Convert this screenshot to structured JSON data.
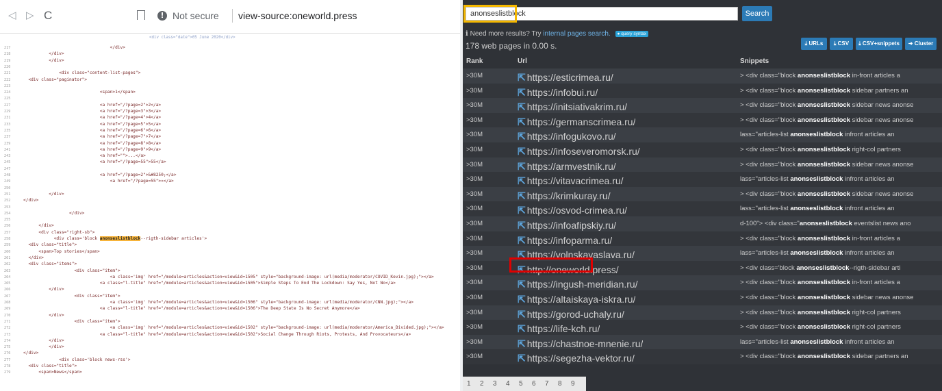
{
  "browser": {
    "nav": {
      "back": "◁",
      "forward": "▷",
      "reload": "C"
    },
    "security_label": "Not secure",
    "url": "view-source:oneworld.press"
  },
  "source": {
    "truncated_top": "<div class=\"date\">05 June 2020</div>",
    "lines": [
      {
        "n": "217",
        "code": "                                  </div>"
      },
      {
        "n": "218",
        "code": "          </div>"
      },
      {
        "n": "219",
        "code": "          </div>"
      },
      {
        "n": "220",
        "code": ""
      },
      {
        "n": "221",
        "code": "              <div class=\"content-list-pages\">"
      },
      {
        "n": "222",
        "code": "  <div class=\"paginator\">"
      },
      {
        "n": "223",
        "code": ""
      },
      {
        "n": "224",
        "code": "                              <span>1</span>"
      },
      {
        "n": "225",
        "code": ""
      },
      {
        "n": "227",
        "code": "                              <a href=\"/?page=2\">2</a>"
      },
      {
        "n": "229",
        "code": "                              <a href=\"/?page=3\">3</a>"
      },
      {
        "n": "231",
        "code": "                              <a href=\"/?page=4\">4</a>"
      },
      {
        "n": "233",
        "code": "                              <a href=\"/?page=5\">5</a>"
      },
      {
        "n": "235",
        "code": "                              <a href=\"/?page=6\">6</a>"
      },
      {
        "n": "237",
        "code": "                              <a href=\"/?page=7\">7</a>"
      },
      {
        "n": "239",
        "code": "                              <a href=\"/?page=8\">8</a>"
      },
      {
        "n": "241",
        "code": "                              <a href=\"/?page=9\">9</a>"
      },
      {
        "n": "243",
        "code": "                              <a href=\"\">...</a>"
      },
      {
        "n": "245",
        "code": "                              <a href=\"/?page=55\">55</a>"
      },
      {
        "n": "247",
        "code": ""
      },
      {
        "n": "248",
        "code": "                              <a href=\"/?page=2\">&#8250;</a>"
      },
      {
        "n": "249",
        "code": "                                  <a href=\"/?page=55\">»</a>"
      },
      {
        "n": "250",
        "code": ""
      },
      {
        "n": "251",
        "code": "          </div>"
      },
      {
        "n": "252",
        "code": "</div>"
      },
      {
        "n": "253",
        "code": ""
      },
      {
        "n": "254",
        "code": "                  </div>"
      },
      {
        "n": "255",
        "code": ""
      },
      {
        "n": "256",
        "code": "      </div>"
      },
      {
        "n": "257",
        "code": "      <div class=\"right-sb\">"
      },
      {
        "n": "258",
        "pre": "            <div class='block ",
        "hl": "anonseslistblock",
        "post": "--rigth-sidebar articles'>"
      },
      {
        "n": "259",
        "code": "  <div class=\"title\">"
      },
      {
        "n": "260",
        "code": "      <span>Top stories</span>"
      },
      {
        "n": "261",
        "code": "  </div>"
      },
      {
        "n": "262",
        "code": "  <div class=\"items\">"
      },
      {
        "n": "263",
        "code": "                    <div class=\"item\">"
      },
      {
        "n": "264",
        "code": "                                  <a class='img' href=\"/module=articles&action=view&id=1505\" style=\"background-image: url(media/moderator/COVID_Kevin.jpg);\"></a>"
      },
      {
        "n": "265",
        "code": "                              <a class=\"l-title\" href=\"/module=articles&action=view&id=1505\">Simple Steps To End The Lockdown: Say Yes, Not No</a>"
      },
      {
        "n": "266",
        "code": "          </div>"
      },
      {
        "n": "267",
        "code": "                    <div class=\"item\">"
      },
      {
        "n": "268",
        "code": "                                  <a class='img' href=\"/module=articles&action=view&id=1506\" style=\"background-image: url(media/moderator/CNN.jpg);\"></a>"
      },
      {
        "n": "269",
        "code": "                              <a class=\"l-title\" href=\"/module=articles&action=view&id=1506\">The Deep State Is No Secret Anymore</a>"
      },
      {
        "n": "270",
        "code": "          </div>"
      },
      {
        "n": "271",
        "code": "                    <div class=\"item\">"
      },
      {
        "n": "272",
        "code": "                                  <a class='img' href=\"/module=articles&action=view&id=1502\" style=\"background-image: url(media/moderator/America_Divided.jpg);\"></a>"
      },
      {
        "n": "273",
        "code": "                              <a class=\"l-title\" href=\"/module=articles&action=view&id=1502\">Social Change Through Riots, Protests, And Provocateurs</a>"
      },
      {
        "n": "274",
        "code": "          </div>"
      },
      {
        "n": "275",
        "code": "          </div>"
      },
      {
        "n": "276",
        "code": "</div>"
      },
      {
        "n": "277",
        "code": "              <div class='block news-rss'>"
      },
      {
        "n": "278",
        "code": "  <div class=\"title\">"
      },
      {
        "n": "279",
        "code": "      <span>News</span>"
      }
    ]
  },
  "search": {
    "query": "anonseslistblock",
    "button_label": "Search",
    "need_more_prefix": "Need more results? Try",
    "need_more_link": "internal pages search.",
    "syntax_badge": "query syntax",
    "result_count": "178 web pages in 0.00 s.",
    "exports": [
      "URLs",
      "CSV",
      "CSV+snippets",
      "Cluster"
    ],
    "columns": {
      "rank": "Rank",
      "url": "Url",
      "snippets": "Snippets"
    },
    "rows": [
      {
        "rank": ">30M",
        "url": "https://esticrimea.ru/",
        "snip_pre": "> <div class=\"block ",
        "snip_b": "anonseslistblock",
        "snip_post": " in-front articles a"
      },
      {
        "rank": ">30M",
        "url": "https://infobui.ru/",
        "snip_pre": "> <div class=\"block ",
        "snip_b": "anonseslistblock",
        "snip_post": " sidebar partners an"
      },
      {
        "rank": ">30M",
        "url": "https://initsiativakrim.ru/",
        "snip_pre": "> <div class=\"block ",
        "snip_b": "anonseslistblock",
        "snip_post": " sidebar news anonse"
      },
      {
        "rank": ">30M",
        "url": "https://germanscrimea.ru/",
        "snip_pre": "> <div class=\"block ",
        "snip_b": "anonseslistblock",
        "snip_post": " sidebar news anonse"
      },
      {
        "rank": ">30M",
        "url": "https://infogukovo.ru/",
        "snip_pre": "lass=\"articles-list ",
        "snip_b": "anonseslistblock",
        "snip_post": " infront articles an"
      },
      {
        "rank": ">30M",
        "url": "https://infoseveromorsk.ru/",
        "snip_pre": "> <div class=\"block ",
        "snip_b": "anonseslistblock",
        "snip_post": " right-col partners"
      },
      {
        "rank": ">30M",
        "url": "https://armvestnik.ru/",
        "snip_pre": "> <div class=\"block ",
        "snip_b": "anonseslistblock",
        "snip_post": " sidebar news anonse"
      },
      {
        "rank": ">30M",
        "url": "https://vitavacrimea.ru/",
        "snip_pre": "lass=\"articles-list ",
        "snip_b": "anonseslistblock",
        "snip_post": " infront articles an"
      },
      {
        "rank": ">30M",
        "url": "https://krimkuray.ru/",
        "snip_pre": "> <div class=\"block ",
        "snip_b": "anonseslistblock",
        "snip_post": " sidebar news anonse"
      },
      {
        "rank": ">30M",
        "url": "https://osvod-crimea.ru/",
        "snip_pre": "lass=\"articles-list ",
        "snip_b": "anonseslistblock",
        "snip_post": " infront articles an"
      },
      {
        "rank": ">30M",
        "url": "https://infoafipskiy.ru/",
        "snip_pre": "d-100\"> <div class=\"",
        "snip_b": "anonseslistblock",
        "snip_post": " eventslist news ano"
      },
      {
        "rank": ">30M",
        "url": "https://infoparma.ru/",
        "snip_pre": "> <div class=\"block ",
        "snip_b": "anonseslistblock",
        "snip_post": " in-front articles a"
      },
      {
        "rank": ">30M",
        "url": "https://volnskayaslava.ru/",
        "snip_pre": "lass=\"articles-list ",
        "snip_b": "anonseslistblock",
        "snip_post": " infront articles an"
      },
      {
        "rank": ">30M",
        "url": "http://oneworld.press/",
        "snip_pre": "> <div class='block ",
        "snip_b": "anonseslistblock",
        "snip_post": "--rigth-sidebar arti"
      },
      {
        "rank": ">30M",
        "url": "https://ingush-meridian.ru/",
        "snip_pre": "> <div class=\"block ",
        "snip_b": "anonseslistblock",
        "snip_post": " in-front articles a"
      },
      {
        "rank": ">30M",
        "url": "https://altaiskaya-iskra.ru/",
        "snip_pre": "> <div class=\"block ",
        "snip_b": "anonseslistblock",
        "snip_post": " sidebar news anonse"
      },
      {
        "rank": ">30M",
        "url": "https://gorod-uchaly.ru/",
        "snip_pre": "> <div class=\"block ",
        "snip_b": "anonseslistblock",
        "snip_post": " right-col partners"
      },
      {
        "rank": ">30M",
        "url": "https://life-kch.ru/",
        "snip_pre": "> <div class=\"block ",
        "snip_b": "anonseslistblock",
        "snip_post": " right-col partners"
      },
      {
        "rank": ">30M",
        "url": "https://chastnoe-mnenie.ru/",
        "snip_pre": "lass=\"articles-list ",
        "snip_b": "anonseslistblock",
        "snip_post": " infront articles an"
      },
      {
        "rank": ">30M",
        "url": "https://segezha-vektor.ru/",
        "snip_pre": "> <div class=\"block ",
        "snip_b": "anonseslistblock",
        "snip_post": " sidebar partners an"
      }
    ],
    "pages": [
      "1",
      "2",
      "3",
      "4",
      "5",
      "6",
      "7",
      "8",
      "9"
    ],
    "highlighted_row": 13
  },
  "colors": {
    "accent": "#2c7bb6",
    "highlight_yellow": "#f5b800",
    "highlight_red": "#e00000",
    "panel_bg": "#2f3237"
  }
}
